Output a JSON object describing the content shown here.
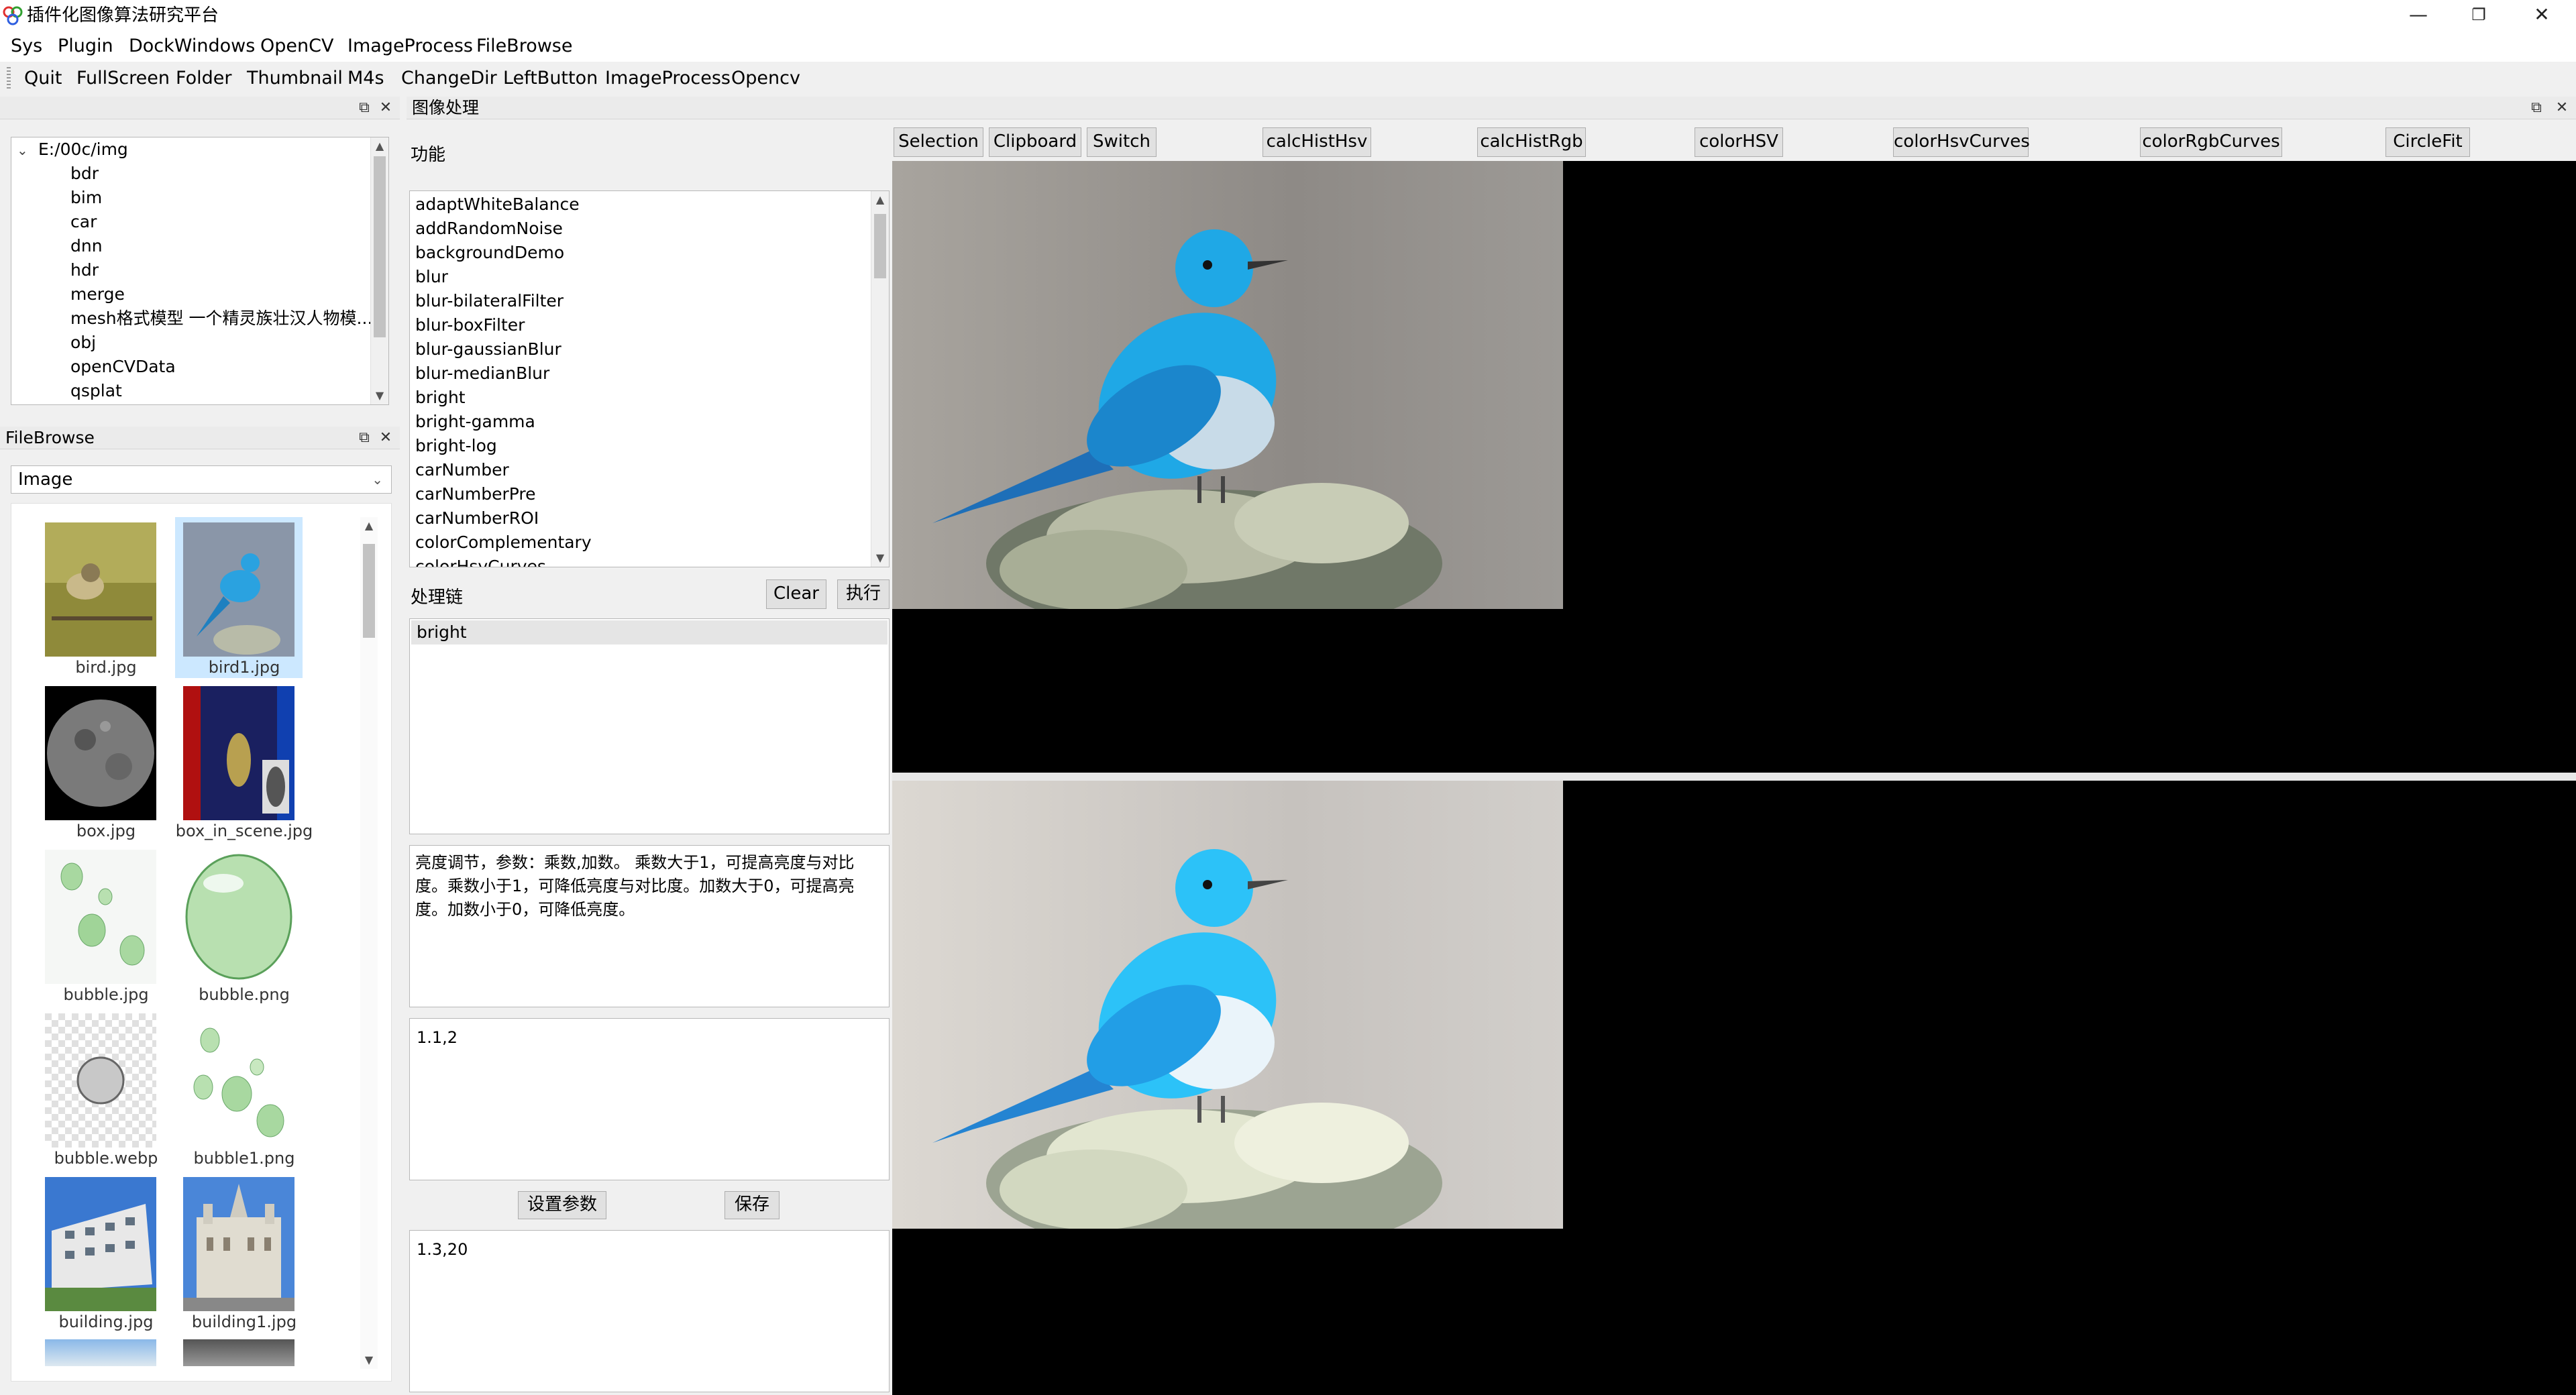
{
  "window": {
    "title": "插件化图像算法研究平台",
    "minimize_glyph": "—",
    "restore_glyph": "❐",
    "close_glyph": "✕"
  },
  "menubar": [
    "Sys",
    "Plugin",
    "DockWindows",
    "OpenCV",
    "ImageProcess",
    "FileBrowse"
  ],
  "toolbar": [
    "Quit",
    "FullScreen",
    "Folder",
    "Thumbnail",
    "M4s",
    "ChangeDir",
    "LeftButton",
    "ImageProcess",
    "Opencv"
  ],
  "dir_tree": {
    "root": "E:/00c/img",
    "children": [
      "bdr",
      "bim",
      "car",
      "dnn",
      "hdr",
      "merge",
      "mesh格式模型 一个精灵族壮汉人物模...",
      "obj",
      "openCVData",
      "qsplat"
    ]
  },
  "filebrowse": {
    "title": "FileBrowse",
    "filter": "Image",
    "files": [
      "bird.jpg",
      "bird1.jpg",
      "box.jpg",
      "box_in_scene.jpg",
      "bubble.jpg",
      "bubble.png",
      "bubble.webp",
      "bubble1.png",
      "building.jpg",
      "building1.jpg"
    ],
    "selected": "bird1.jpg"
  },
  "imgproc": {
    "title": "图像处理",
    "func_label": "功能",
    "functions": [
      "adaptWhiteBalance",
      "addRandomNoise",
      "backgroundDemo",
      "blur",
      "blur-bilateralFilter",
      "blur-boxFilter",
      "blur-gaussianBlur",
      "blur-medianBlur",
      "bright",
      "bright-gamma",
      "bright-log",
      "carNumber",
      "carNumberPre",
      "carNumberROI",
      "colorComplementary",
      "colorHsvCurves"
    ],
    "chain_label": "处理链",
    "clear_label": "Clear",
    "run_label": "执行",
    "chain": [
      "bright"
    ],
    "description": "亮度调节，参数：乘数,加数。 乘数大于1，可提高亮度与对比度。乘数小于1，可降低亮度与对比度。加数大于0，可提高亮度。加数小于0，可降低亮度。",
    "params_current": "1.1,2",
    "set_params_label": "设置参数",
    "save_label": "保存",
    "params_saved": "1.3,20"
  },
  "viewer_buttons": [
    "Selection",
    "Clipboard",
    "Switch",
    "calcHistHsv",
    "calcHistRgb",
    "colorHSV",
    "colorHsvCurves",
    "colorRgbCurves",
    "CircleFit"
  ],
  "colors": {
    "accent_selection": "#cce8ff",
    "viewer_bg": "#000000",
    "bird_blue": "#1fa8e6"
  }
}
